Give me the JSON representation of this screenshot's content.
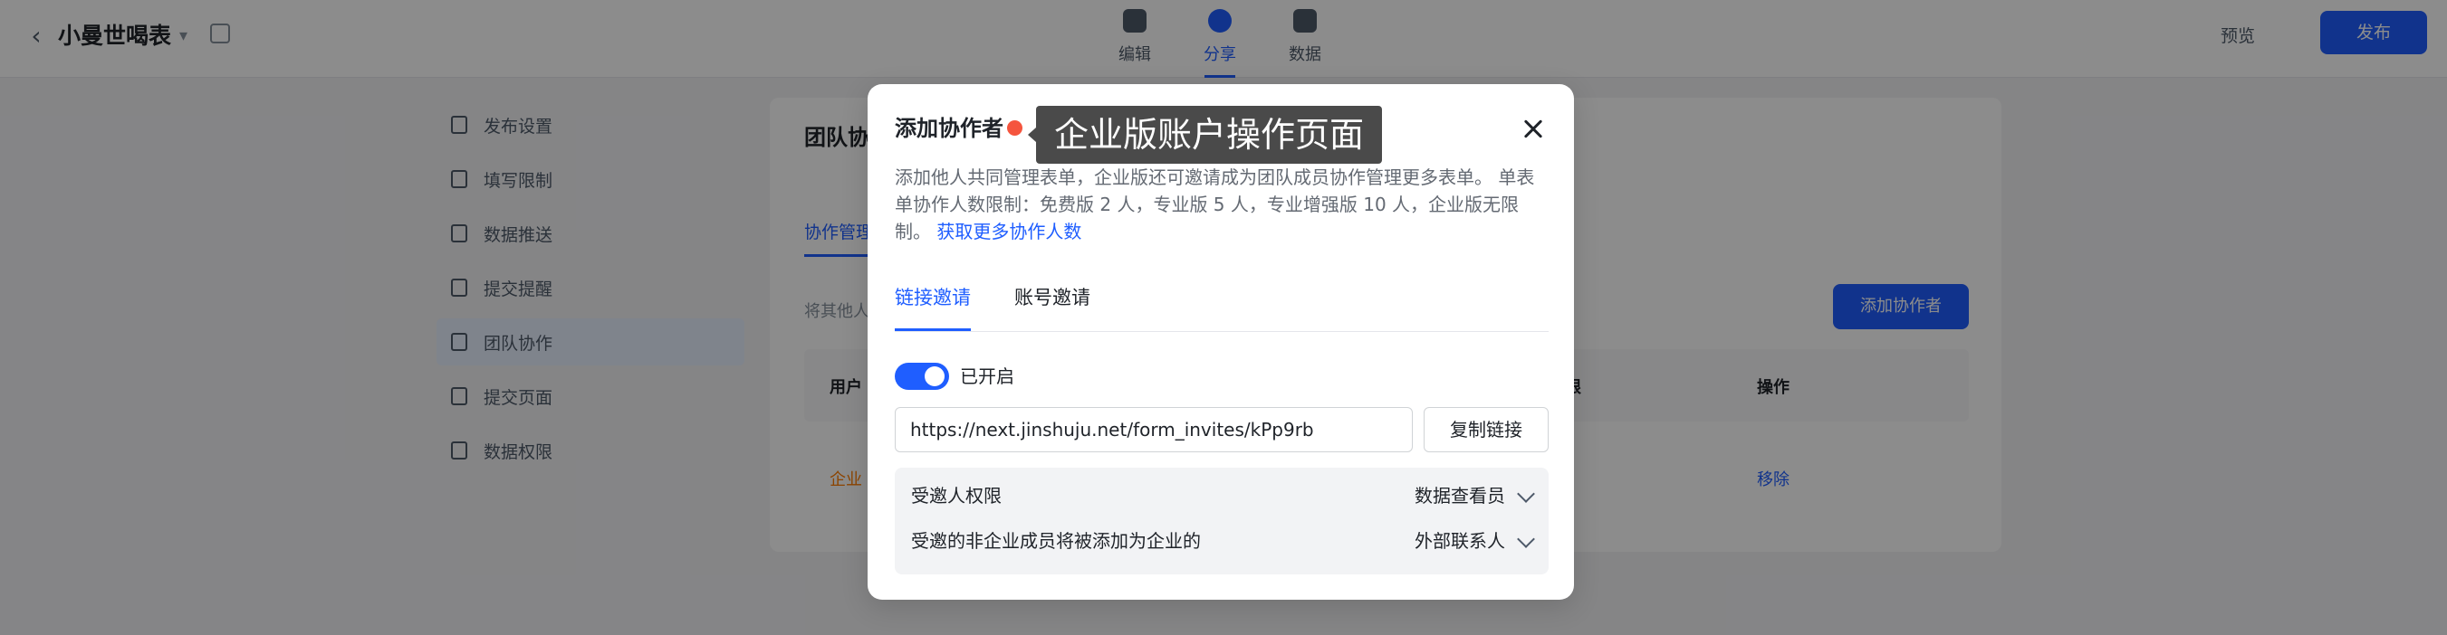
{
  "header": {
    "form_title": "小曼世喝表",
    "nav_tabs": [
      {
        "label": "编辑",
        "icon": "edit-icon"
      },
      {
        "label": "分享",
        "icon": "share-icon"
      },
      {
        "label": "数据",
        "icon": "data-icon"
      }
    ],
    "preview_label": "预览",
    "publish_label": "发布"
  },
  "sidebar": {
    "items": [
      {
        "label": "发布设置"
      },
      {
        "label": "填写限制"
      },
      {
        "label": "数据推送"
      },
      {
        "label": "提交提醒"
      },
      {
        "label": "团队协作"
      },
      {
        "label": "提交页面"
      },
      {
        "label": "数据权限"
      }
    ]
  },
  "panel": {
    "title": "团队协作",
    "tab_label": "协作管理",
    "desc": "将其他人加入到表单协作中，可以共同管理表单…",
    "add_button": "添加协作者",
    "columns": [
      "用户",
      "权限",
      "操作"
    ],
    "row_name": "企业",
    "row_action": "移除"
  },
  "modal": {
    "title": "添加协作者",
    "tooltip": "企业版账户操作页面",
    "description": "添加他人共同管理表单，企业版还可邀请成为团队成员协作管理更多表单。 单表单协作人数限制：免费版 2 人，专业版 5 人，专业增强版 10 人，企业版无限制。",
    "description_link": "获取更多协作人数",
    "tabs": [
      {
        "label": "链接邀请",
        "active": true
      },
      {
        "label": "账号邀请",
        "active": false
      }
    ],
    "toggle": {
      "label": "已开启",
      "on": true
    },
    "invite_link": "https://next.jinshuju.net/form_invites/kPp9rb",
    "copy_button": "复制链接",
    "settings": [
      {
        "label": "受邀人权限",
        "value": "数据查看员"
      },
      {
        "label": "受邀的非企业成员将被添加为企业的",
        "value": "外部联系人"
      }
    ]
  },
  "colors": {
    "accent": "#1f5eff",
    "record_dot": "#f5553e",
    "tooltip_bg": "#4a4a4a"
  }
}
